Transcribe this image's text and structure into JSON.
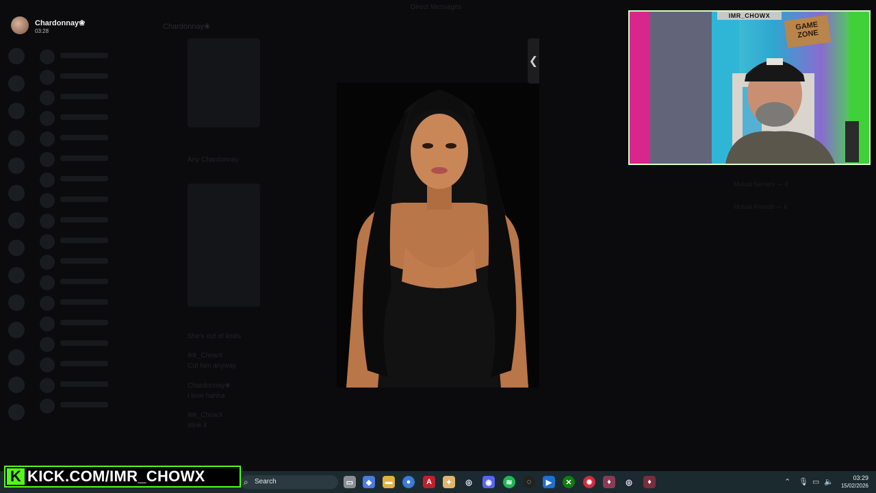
{
  "app": {
    "window_title": "Direct Messages"
  },
  "user_header": {
    "name": "Chardonnay❀",
    "time": "03:28"
  },
  "chat": {
    "channel_name": "Chardonnay❀",
    "ghost_lines": [
      "Any Chardonnay",
      "She's out of limits"
    ],
    "messages": [
      {
        "author": "iMr_ChowX",
        "text": "Cut him anyway"
      },
      {
        "author": "Chardonnay❀",
        "text": "I love hahha"
      },
      {
        "author": "iMr_ChowX",
        "text": "stink it"
      }
    ]
  },
  "sidebar_right": {
    "items": [
      "Mutual Servers — 4",
      "Mutual Friends — 6"
    ]
  },
  "viewer": {
    "collapse_glyph": "❮"
  },
  "webcam": {
    "label": "IMR_CHOWX",
    "sign": "GAME ZONE"
  },
  "stream_banner": {
    "logo_letter": "K",
    "url": "KICK.COM/IMR_CHOWX"
  },
  "taskbar": {
    "search_placeholder": "Search",
    "search_icon": "magnifier",
    "pinned_apps": [
      "task-view",
      "copilot",
      "file-explorer",
      "chrome",
      "adobe-acrobat",
      "streamer-tool",
      "steam",
      "discord",
      "spotify",
      "obs",
      "vscode-like",
      "xbox",
      "app-red",
      "app-pink",
      "steam-2",
      "app-pin"
    ],
    "tray_icons": [
      "chevron-up",
      "microphone",
      "network",
      "volume"
    ],
    "clock_time": "03:29",
    "clock_date": "15/02/2026"
  },
  "colors": {
    "kick_green": "#53fc18",
    "taskbar_bg": "#1b2a2f"
  }
}
